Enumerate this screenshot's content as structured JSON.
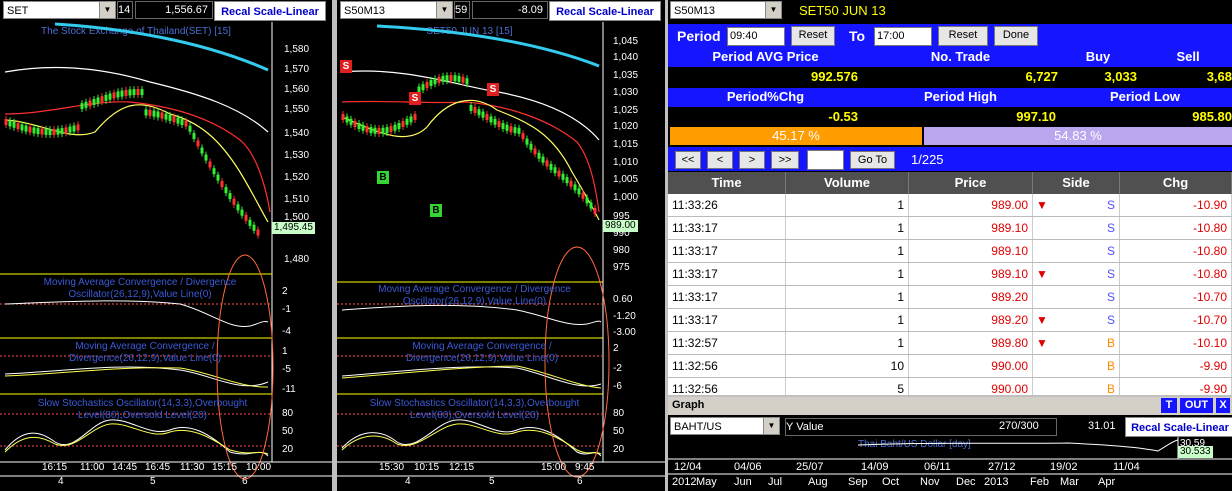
{
  "left_chart": {
    "symbol": "SET",
    "value_a": "14",
    "value_b": "1,556.67",
    "recal": "Recal Scale-Linear",
    "title": "The Stock Exchange of Thailand(SET) [15]",
    "price_ticks": [
      "1,580",
      "1,570",
      "1,560",
      "1,550",
      "1,540",
      "1,530",
      "1,520",
      "1,510",
      "1,500",
      "1,480"
    ],
    "last_price": "1,495.45",
    "macd1_label": "Moving Average Convergence / Divergence Oscillator(26,12,9),Value Line(0)",
    "macd1_ticks": [
      "2",
      "-1",
      "-4"
    ],
    "macd2_label": "Moving Average Convergence / Divergence(26,12,9),Value Line(0)",
    "macd2_ticks": [
      "1",
      "-5",
      "-11"
    ],
    "stoch_label": "Slow Stochastics Oscillator(14,3,3),Overbought Level(80),Oversold Level(20)",
    "stoch_ticks": [
      "80",
      "50",
      "20"
    ],
    "times": [
      "16:15",
      "11:00",
      "14:45",
      "16:45",
      "11:30",
      "15:15",
      "10:00"
    ],
    "days": [
      "4",
      "5",
      "6"
    ]
  },
  "mid_chart": {
    "symbol": "S50M13",
    "value_a": "59",
    "value_b": "-8.09",
    "recal": "Recal Scale-Linear",
    "title": "SET50 JUN 13 [15]",
    "price_ticks": [
      "1,045",
      "1,040",
      "1,035",
      "1,030",
      "1,025",
      "1,020",
      "1,015",
      "1,010",
      "1,005",
      "1,000",
      "995",
      "990",
      "980",
      "975"
    ],
    "last_price": "989.00",
    "macd1_label": "Moving Average Convergence / Divergence Oscillator(26,12,9),Value Line(0)",
    "macd1_ticks": [
      "0.60",
      "-1.20",
      "-3.00"
    ],
    "macd2_label": "Moving Average Convergence / Divergence(26,12,9),Value Line(0)",
    "macd2_ticks": [
      "2",
      "-2",
      "-6"
    ],
    "stoch_label": "Slow Stochastics Oscillator(14,3,3),Overbought Level(80),Oversold Level(20)",
    "stoch_ticks": [
      "80",
      "50",
      "20"
    ],
    "times": [
      "15:30",
      "10:15",
      "12:15",
      "15:00",
      "9:45"
    ],
    "days": [
      "4",
      "5",
      "6"
    ],
    "signal_s": "S",
    "signal_b": "B"
  },
  "trade": {
    "symbol": "S50M13",
    "name": "SET50 JUN 13",
    "period_label": "Period",
    "period_from": "09:40",
    "to_label": "To",
    "period_to": "17:00",
    "reset": "Reset",
    "done": "Done",
    "h_avg": "Period AVG Price",
    "h_ntrade": "No. Trade",
    "h_buy": "Buy",
    "h_sell": "Sell",
    "v_avg": "992.576",
    "v_ntrade": "6,727",
    "v_buy": "3,033",
    "v_sell": "3,68",
    "h_chg": "Period%Chg",
    "h_high": "Period High",
    "h_low": "Period Low",
    "v_chg": "-0.53",
    "v_high": "997.10",
    "v_low": "985.80",
    "buy_pct": "45.17 %",
    "sell_pct": "54.83 %",
    "buy_ratio": 0.4517,
    "nav_first": "<<",
    "nav_prev": "<",
    "nav_next": ">",
    "nav_last": ">>",
    "goto": "Go To",
    "page": "1/225",
    "cols": [
      "Time",
      "Volume",
      "Price",
      "Side",
      "Chg"
    ],
    "rows": [
      {
        "time": "11:33:26",
        "vol": "1",
        "price": "989.00",
        "arrow": true,
        "side": "S",
        "chg": "-10.90"
      },
      {
        "time": "11:33:17",
        "vol": "1",
        "price": "989.10",
        "arrow": false,
        "side": "S",
        "chg": "-10.80"
      },
      {
        "time": "11:33:17",
        "vol": "1",
        "price": "989.10",
        "arrow": false,
        "side": "S",
        "chg": "-10.80"
      },
      {
        "time": "11:33:17",
        "vol": "1",
        "price": "989.10",
        "arrow": true,
        "side": "S",
        "chg": "-10.80"
      },
      {
        "time": "11:33:17",
        "vol": "1",
        "price": "989.20",
        "arrow": false,
        "side": "S",
        "chg": "-10.70"
      },
      {
        "time": "11:33:17",
        "vol": "1",
        "price": "989.20",
        "arrow": true,
        "side": "S",
        "chg": "-10.70"
      },
      {
        "time": "11:32:57",
        "vol": "1",
        "price": "989.80",
        "arrow": true,
        "side": "B",
        "chg": "-10.10"
      },
      {
        "time": "11:32:56",
        "vol": "10",
        "price": "990.00",
        "arrow": false,
        "side": "B",
        "chg": "-9.90"
      },
      {
        "time": "11:32:56",
        "vol": "5",
        "price": "990.00",
        "arrow": false,
        "side": "B",
        "chg": "-9.90"
      }
    ]
  },
  "graph": {
    "title": "Graph",
    "t_btn": "T",
    "out_btn": "OUT",
    "x_btn": "X",
    "symbol": "BAHT/US",
    "y_label": "Y Value",
    "count": "270/300",
    "y_val": "31.01",
    "recal": "Recal Scale-Linear",
    "series_title": "Thai Baht/US Dollar [day]",
    "tick_top": "30.59",
    "last": "30.533",
    "dates": [
      "12/04",
      "04/06",
      "25/07",
      "14/09",
      "06/11",
      "27/12",
      "19/02",
      "11/04"
    ],
    "months": [
      "2012",
      "May",
      "Jun",
      "Jul",
      "Aug",
      "Sep",
      "Oct",
      "Nov",
      "Dec",
      "2013",
      "Feb",
      "Mar",
      "Apr"
    ]
  },
  "colors": {
    "blue": "#1515ff",
    "orange": "#ff9c00",
    "purple": "#b9a6ee",
    "yellow": "#ffff00",
    "red_price": "#e00000",
    "side": "#5050ff",
    "side_b": "#ff8a00"
  }
}
